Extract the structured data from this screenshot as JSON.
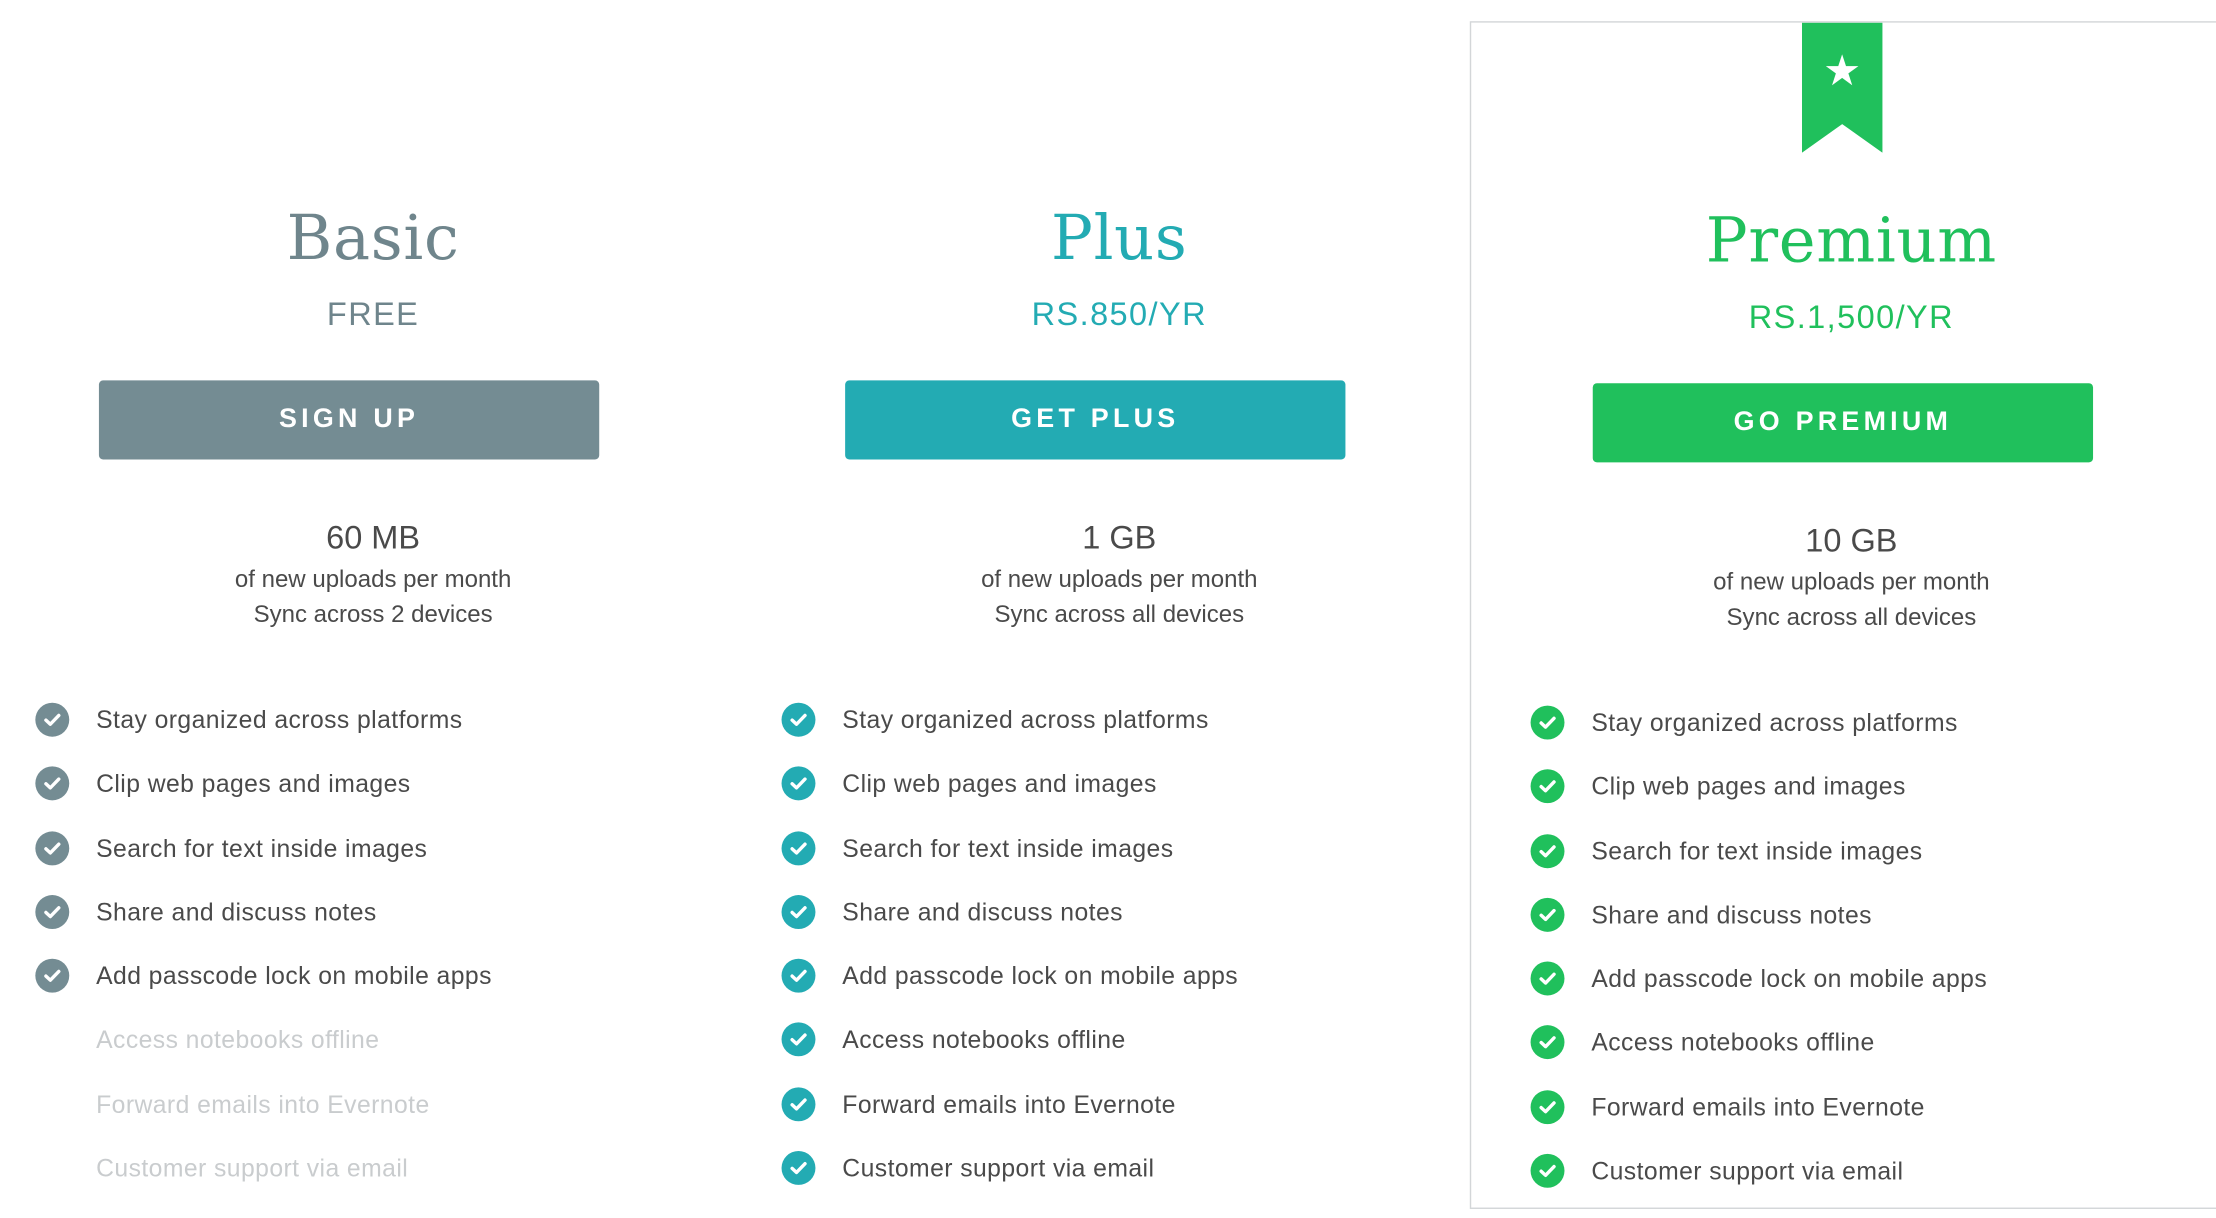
{
  "plans": [
    {
      "name": "Basic",
      "price": "FREE",
      "cta": "SIGN UP",
      "storage": "60 MB",
      "uploads": "of new uploads per month",
      "sync": "Sync across 2 devices",
      "accent": "#748c93",
      "title_color": "#6f858c",
      "features": [
        {
          "label": "Stay organized across platforms",
          "included": true
        },
        {
          "label": "Clip web pages and images",
          "included": true
        },
        {
          "label": "Search for text inside images",
          "included": true
        },
        {
          "label": "Share and discuss notes",
          "included": true
        },
        {
          "label": "Add passcode lock on mobile apps",
          "included": true
        },
        {
          "label": "Access notebooks offline",
          "included": false
        },
        {
          "label": "Forward emails into Evernote",
          "included": false
        },
        {
          "label": "Customer support via email",
          "included": false
        }
      ]
    },
    {
      "name": "Plus",
      "price": "RS.850/YR",
      "cta": "GET PLUS",
      "storage": "1 GB",
      "uploads": "of new uploads per month",
      "sync": "Sync across all devices",
      "accent": "#23abb3",
      "title_color": "#23abb3",
      "features": [
        {
          "label": "Stay organized across platforms",
          "included": true
        },
        {
          "label": "Clip web pages and images",
          "included": true
        },
        {
          "label": "Search for text inside images",
          "included": true
        },
        {
          "label": "Share and discuss notes",
          "included": true
        },
        {
          "label": "Add passcode lock on mobile apps",
          "included": true
        },
        {
          "label": "Access notebooks offline",
          "included": true
        },
        {
          "label": "Forward emails into Evernote",
          "included": true
        },
        {
          "label": "Customer support via email",
          "included": true
        }
      ]
    },
    {
      "name": "Premium",
      "price": "RS.1,500/YR",
      "cta": "GO PREMIUM",
      "storage": "10 GB",
      "uploads": "of new uploads per month",
      "sync": "Sync across all devices",
      "accent": "#20c05c",
      "title_color": "#20c05c",
      "featured_icon": "star-icon",
      "features": [
        {
          "label": "Stay organized across platforms",
          "included": true
        },
        {
          "label": "Clip web pages and images",
          "included": true
        },
        {
          "label": "Search for text inside images",
          "included": true
        },
        {
          "label": "Share and discuss notes",
          "included": true
        },
        {
          "label": "Add passcode lock on mobile apps",
          "included": true
        },
        {
          "label": "Access notebooks offline",
          "included": true
        },
        {
          "label": "Forward emails into Evernote",
          "included": true
        },
        {
          "label": "Customer support via email",
          "included": true
        }
      ]
    }
  ]
}
